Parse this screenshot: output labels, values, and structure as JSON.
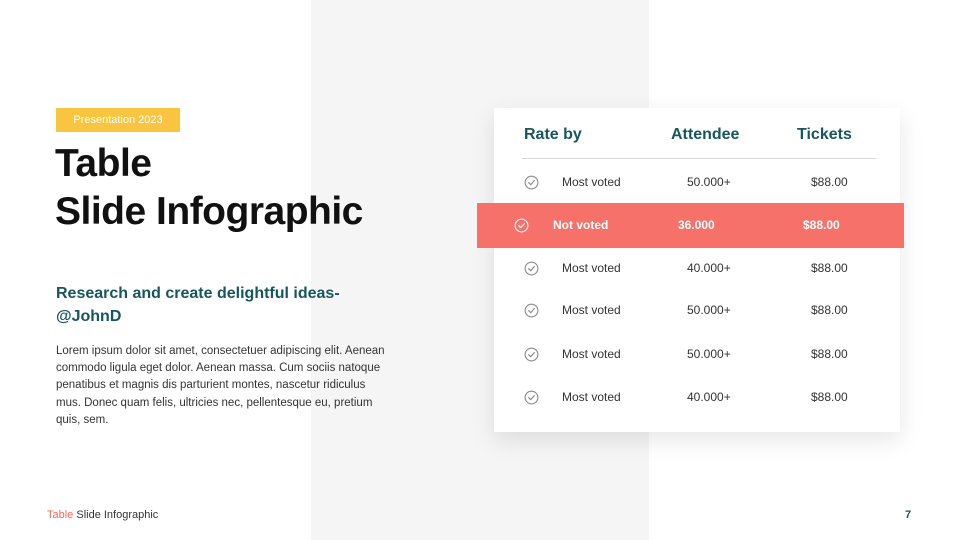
{
  "tag": "Presentation 2023",
  "title": {
    "line1": "Table",
    "line2": "Slide Infographic"
  },
  "subtitle": {
    "line1": "Research and create delightful ideas-",
    "line2": "@JohnD"
  },
  "body": "Lorem  ipsum dolor sit amet, consectetuer adipiscing elit. Aenean commodo ligula eget dolor. Aenean massa. Cum sociis natoque penatibus et magnis dis parturient montes, nascetur ridiculus mus. Donec quam felis, ultricies nec, pellentesque eu, pretium quis, sem.",
  "table": {
    "headers": {
      "rate": "Rate by",
      "attendee": "Attendee",
      "tickets": "Tickets"
    },
    "rows": [
      {
        "label": "Most voted",
        "attendee": "50.000+",
        "tickets": "$88.00",
        "icon": "check-circle-icon"
      },
      {
        "label": "Not voted",
        "attendee": "36.000",
        "tickets": "$88.00",
        "icon": "check-circle-icon",
        "highlighted": true
      },
      {
        "label": "Most voted",
        "attendee": "40.000+",
        "tickets": "$88.00",
        "icon": "check-circle-icon"
      },
      {
        "label": "Most voted",
        "attendee": "50.000+",
        "tickets": "$88.00",
        "icon": "check-circle-icon"
      },
      {
        "label": "Most voted",
        "attendee": "50.000+",
        "tickets": "$88.00",
        "icon": "check-circle-icon"
      },
      {
        "label": "Most voted",
        "attendee": "40.000+",
        "tickets": "$88.00",
        "icon": "check-circle-icon"
      }
    ]
  },
  "footer": {
    "accent": "Table",
    "rest": " Slide Infographic",
    "page": "7"
  },
  "colors": {
    "accent": "#f26b5b",
    "highlight": "#f6716a",
    "teal": "#17565e",
    "tag": "#f9c440"
  }
}
